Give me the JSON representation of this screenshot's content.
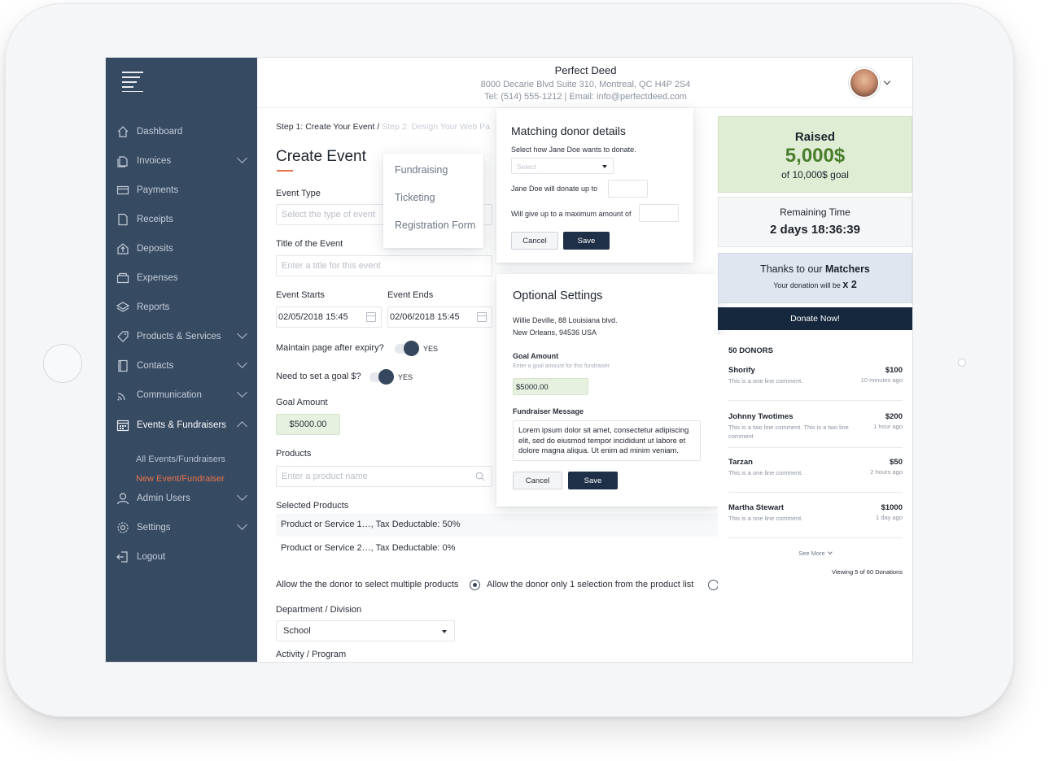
{
  "org": {
    "name": "Perfect Deed",
    "address": "8000 Decarie Blvd Suite 310, Montreal, QC H4P 2S4",
    "contact": "Tel: (514) 555-1212 | Email: info@perfectdeed.com"
  },
  "sidebar": {
    "items": [
      {
        "label": "Dashboard",
        "icon": "home-icon"
      },
      {
        "label": "Invoices",
        "icon": "invoice-icon"
      },
      {
        "label": "Payments",
        "icon": "card-icon"
      },
      {
        "label": "Receipts",
        "icon": "receipt-icon"
      },
      {
        "label": "Deposits",
        "icon": "deposit-icon"
      },
      {
        "label": "Expenses",
        "icon": "wallet-icon"
      },
      {
        "label": "Reports",
        "icon": "layers-icon"
      },
      {
        "label": "Products & Services",
        "icon": "tag-icon"
      },
      {
        "label": "Contacts",
        "icon": "contacts-icon"
      },
      {
        "label": "Communication",
        "icon": "rss-icon"
      },
      {
        "label": "Events & Fundraisers",
        "icon": "calendar-icon"
      },
      {
        "label": "Admin Users",
        "icon": "user-icon"
      },
      {
        "label": "Settings",
        "icon": "gear-icon"
      },
      {
        "label": "Logout",
        "icon": "logout-icon"
      }
    ],
    "sub_items": [
      "All Events/Fundraisers",
      "New Event/Fundraiser"
    ]
  },
  "form": {
    "step_current": "Step 1: Create Your Event /",
    "step_next": " Step 2: Design Your Web Pa",
    "title": "Create Event",
    "event_type_label": "Event Type",
    "event_type_placeholder": "Select the type of event",
    "event_title_label": "Title of the Event",
    "event_title_placeholder": "Enter a title for this event",
    "starts_label": "Event Starts",
    "starts_value": "02/05/2018 15:45",
    "ends_label": "Event Ends",
    "ends_value": "02/06/2018 15:45",
    "maintain_label": "Maintain page after expiry?",
    "maintain_value": "YES",
    "goal_q_label": "Need to set a goal $?",
    "goal_q_value": "YES",
    "goal_label": "Goal Amount",
    "goal_value": "$5000.00",
    "products_label": "Products",
    "products_placeholder": "Enter a product name",
    "selected_label": "Selected Products",
    "selected": [
      "Product or Service 1…, Tax Deductable: 50%",
      "Product or Service 2…, Tax Deductable: 0%"
    ],
    "multi_option": "Allow the the donor to select multiple products",
    "single_option": "Allow the donor only 1 selection from the product list",
    "department_label": "Department / Division",
    "department_value": "School",
    "activity_label": "Activity / Program"
  },
  "type_dropdown": [
    "Fundraising",
    "Ticketing",
    "Registration Form"
  ],
  "matching": {
    "title": "Matching donor details",
    "subtitle": "Select how Jane Doe wants to donate.",
    "select_placeholder": "Select",
    "donate_up_to": "Jane Doe will donate up to",
    "max_amount": "Will give up to a maximum amount of",
    "cancel": "Cancel",
    "save": "Save"
  },
  "optional": {
    "title": "Optional Settings",
    "address1": "Willie Deville, 88 Louisiana blvd.",
    "address2": "New Orleans, 94536 USA",
    "goal_label": "Goal Amount",
    "goal_hint": "Enter a goal amount for this fundraiser",
    "goal_value": "$5000.00",
    "message_label": "Fundraiser Message",
    "message": "Lorem ipsum dolor sit amet, consectetur adipiscing elit, sed do eiusmod tempor incididunt ut labore et dolore magna aliqua. Ut enim ad minim veniam.",
    "cancel": "Cancel",
    "save": "Save"
  },
  "campaign": {
    "raised_label": "Raised",
    "raised_amount": "5,000$",
    "goal_text": "of 10,000$ goal",
    "remaining_label": "Remaining Time",
    "remaining_value": "2 days 18:36:39",
    "thanks_prefix": "Thanks to our ",
    "thanks_bold": "Matchers",
    "multiplier_prefix": "Your donation will be ",
    "multiplier_value": "x 2",
    "donate_button": "Donate Now!",
    "donors_heading": "50 DONORS",
    "donors": [
      {
        "name": "Shorify",
        "amount": "$100",
        "comment": "This is a one line comment.",
        "time": "10 minutes ago"
      },
      {
        "name": "Johnny Twotimes",
        "amount": "$200",
        "comment": "This is a two line comment. This is a two line comment",
        "time": "1 hour ago"
      },
      {
        "name": "Tarzan",
        "amount": "$50",
        "comment": "This is a one line comment.",
        "time": "2 hours ago"
      },
      {
        "name": "Martha Stewart",
        "amount": "$1000",
        "comment": "This is a one line comment.",
        "time": "1 day ago"
      }
    ],
    "see_more": "See More",
    "viewing": "Viewing 5 of 60 Donations"
  },
  "colors": {
    "sidebar": "#364a62",
    "accent": "#e8734a",
    "navy": "#1e3047",
    "raised_green": "#4a7d2c"
  }
}
